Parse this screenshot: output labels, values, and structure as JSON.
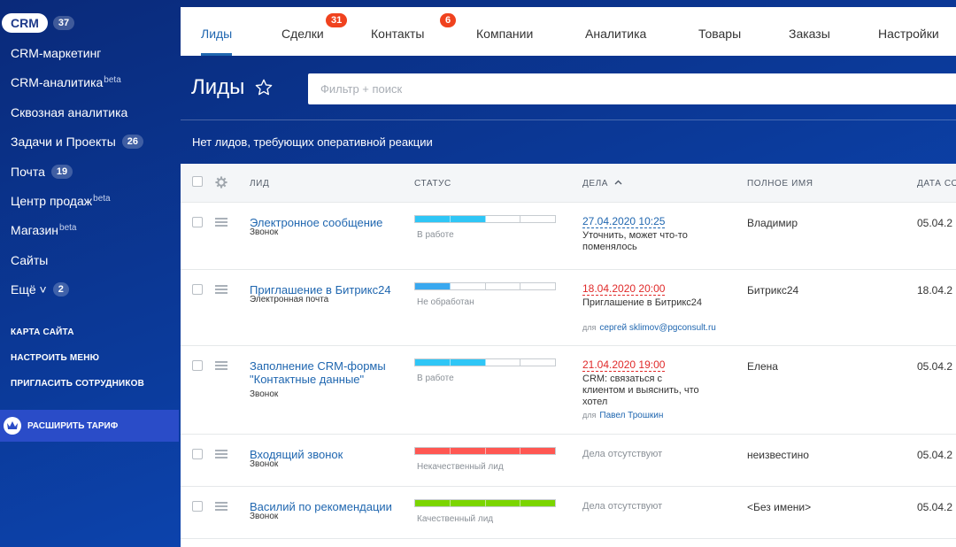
{
  "sidebar": {
    "crm": {
      "label": "CRM",
      "badge": "37"
    },
    "items": [
      {
        "label": "CRM-маркетинг",
        "sup": "",
        "badge": ""
      },
      {
        "label": "CRM-аналитика",
        "sup": "beta",
        "badge": ""
      },
      {
        "label": "Сквозная аналитика",
        "sup": "",
        "badge": ""
      },
      {
        "label": "Задачи и Проекты",
        "sup": "",
        "badge": "26"
      },
      {
        "label": "Почта",
        "sup": "",
        "badge": "19"
      },
      {
        "label": "Центр продаж",
        "sup": "beta",
        "badge": ""
      },
      {
        "label": "Магазин",
        "sup": "beta",
        "badge": ""
      },
      {
        "label": "Сайты",
        "sup": "",
        "badge": ""
      },
      {
        "label": "Ещё ˅",
        "sup": "",
        "badge": "2"
      }
    ],
    "links": [
      "КАРТА САЙТА",
      "НАСТРОИТЬ МЕНЮ",
      "ПРИГЛАСИТЬ СОТРУДНИКОВ"
    ],
    "tariff_label": "РАСШИРИТЬ ТАРИФ"
  },
  "tabs": [
    {
      "label": "Лиды",
      "badge": "",
      "active": true
    },
    {
      "label": "Сделки",
      "badge": "31",
      "active": false
    },
    {
      "label": "Контакты",
      "badge": "6",
      "active": false
    },
    {
      "label": "Компании",
      "badge": "",
      "active": false
    },
    {
      "label": "Аналитика",
      "badge": "",
      "active": false
    },
    {
      "label": "Товары",
      "badge": "",
      "active": false
    },
    {
      "label": "Заказы",
      "badge": "",
      "active": false
    },
    {
      "label": "Настройки",
      "badge": "",
      "active": false
    }
  ],
  "page": {
    "title": "Лиды",
    "filter_placeholder": "Фильтр + поиск",
    "notice": "Нет лидов, требующих оперативной реакции"
  },
  "grid": {
    "columns": [
      "ЛИД",
      "СТАТУС",
      "ДЕЛА",
      "ПОЛНОЕ ИМЯ",
      "ДАТА СО"
    ],
    "sort_indicator": "^",
    "rows": [
      {
        "title": "Электронное сообщение",
        "source": "Звонок",
        "status_label": "В работе",
        "status_steps": 2,
        "status_color": "#2fc6f6",
        "deal_date": "27.04.2020 10:25",
        "deal_overdue": false,
        "deal_text": "Уточнить, может что-то поменялось",
        "resp_prefix": "",
        "resp_name": "",
        "no_deals": "",
        "fullname": "Владимир",
        "created": "05.04.2"
      },
      {
        "title": "Приглашение в Битрикс24",
        "source": "Электронная почта",
        "status_label": "Не обработан",
        "status_steps": 1,
        "status_color": "#39a8ef",
        "deal_date": "18.04.2020 20:00",
        "deal_overdue": true,
        "deal_text": "Приглашение в Битрикс24",
        "resp_prefix": "для",
        "resp_name": "сергей sklimov@pgconsult.ru",
        "no_deals": "",
        "fullname": "Битрикс24",
        "created": "18.04.2"
      },
      {
        "title": "Заполнение CRM-формы \"Контактные данные\"",
        "source": "Звонок",
        "status_label": "В работе",
        "status_steps": 2,
        "status_color": "#2fc6f6",
        "deal_date": "21.04.2020 19:00",
        "deal_overdue": true,
        "deal_text": "CRM: связаться с клиентом и выяснить, что хотел",
        "resp_prefix": "для",
        "resp_name": "Павел Трошкин",
        "no_deals": "",
        "fullname": "Елена",
        "created": "05.04.2"
      },
      {
        "title": "Входящий звонок",
        "source": "Звонок",
        "status_label": "Некачественный лид",
        "status_steps": 4,
        "status_color": "#ff5752",
        "deal_date": "",
        "deal_overdue": false,
        "deal_text": "",
        "resp_prefix": "",
        "resp_name": "",
        "no_deals": "Дела отсутствуют",
        "fullname": "неизвестино",
        "created": "05.04.2"
      },
      {
        "title": "Василий по рекомендации",
        "source": "Звонок",
        "status_label": "Качественный лид",
        "status_steps": 4,
        "status_color": "#7bd500",
        "deal_date": "",
        "deal_overdue": false,
        "deal_text": "",
        "resp_prefix": "",
        "resp_name": "",
        "no_deals": "Дела отсутствуют",
        "fullname": "<Без имени>",
        "created": "05.04.2"
      }
    ]
  }
}
